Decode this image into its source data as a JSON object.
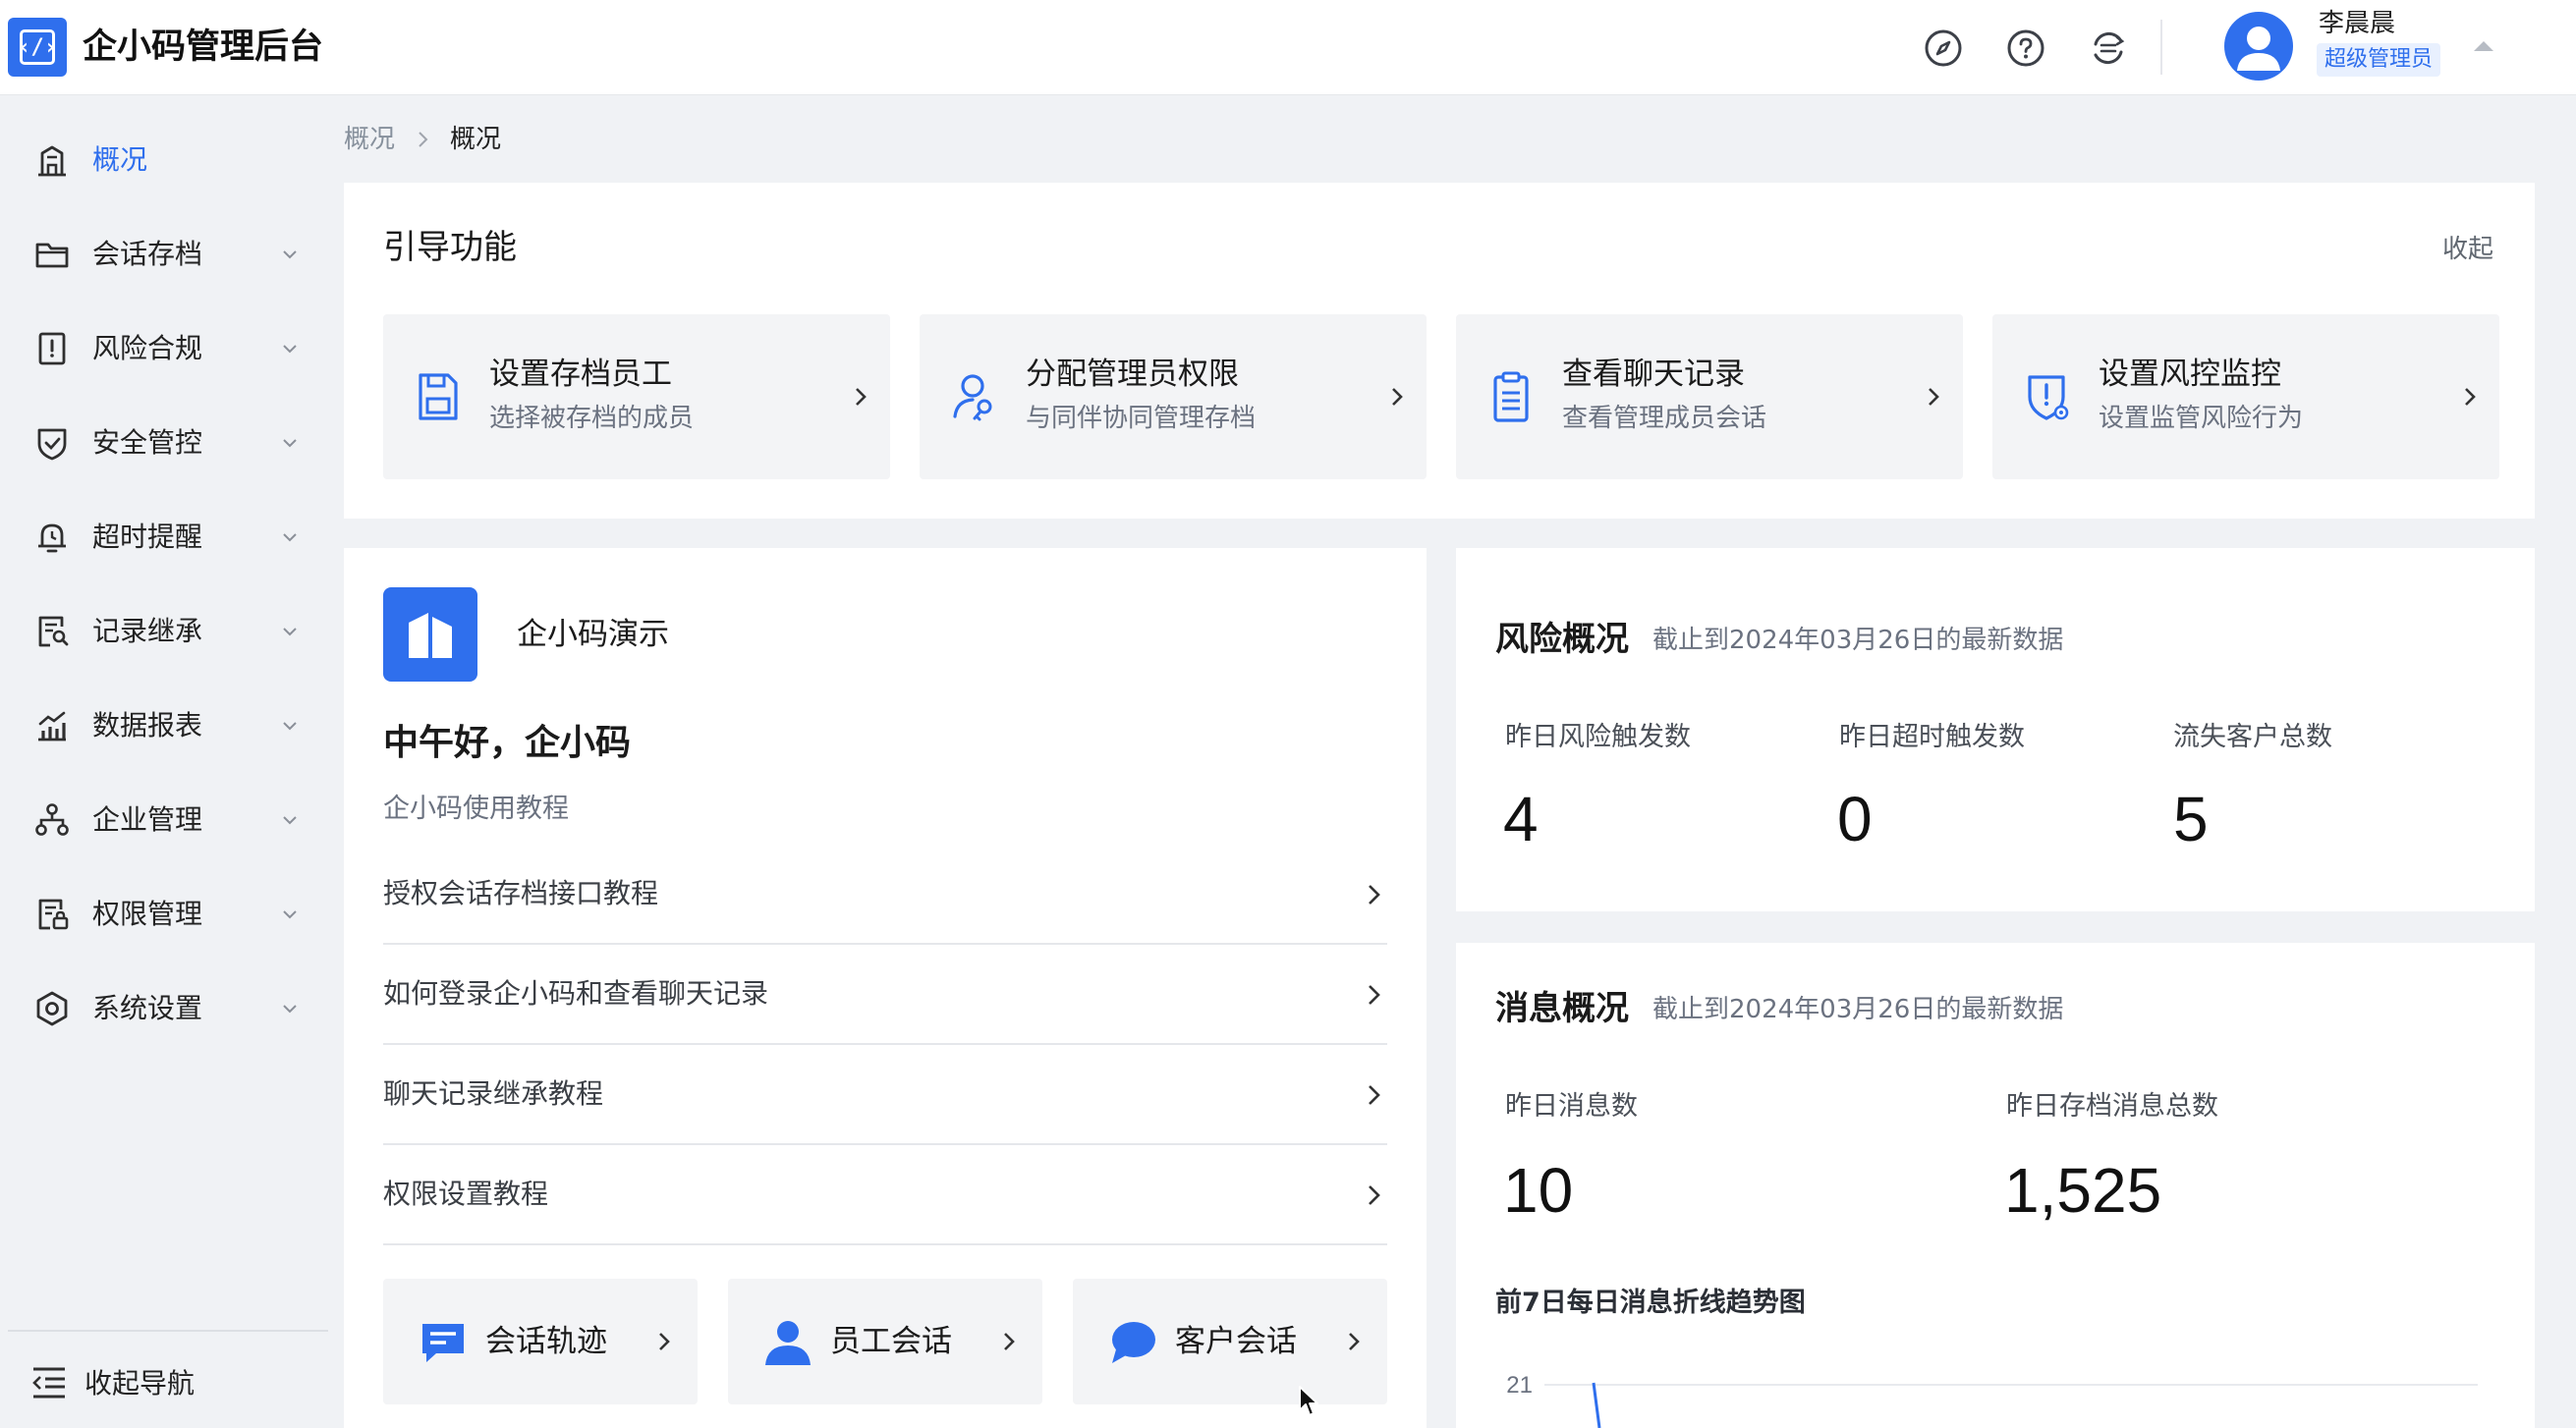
{
  "app": {
    "title": "企小码管理后台",
    "brand_color": "#2f6fed"
  },
  "user": {
    "name": "李晨晨",
    "role": "超级管理员"
  },
  "header_icons": [
    "compass-icon",
    "help-icon",
    "switch-icon"
  ],
  "sidebar": {
    "items": [
      {
        "label": "概况",
        "icon": "building-icon",
        "active": true
      },
      {
        "label": "会话存档",
        "icon": "folder-icon"
      },
      {
        "label": "风险合规",
        "icon": "alert-book-icon"
      },
      {
        "label": "安全管控",
        "icon": "shield-check-icon"
      },
      {
        "label": "超时提醒",
        "icon": "alarm-bell-icon"
      },
      {
        "label": "记录继承",
        "icon": "record-icon"
      },
      {
        "label": "数据报表",
        "icon": "chart-icon"
      },
      {
        "label": "企业管理",
        "icon": "org-tree-icon"
      },
      {
        "label": "权限管理",
        "icon": "permission-icon"
      },
      {
        "label": "系统设置",
        "icon": "settings-icon"
      }
    ],
    "collapse_label": "收起导航"
  },
  "breadcrumb": {
    "parent": "概况",
    "current": "概况"
  },
  "guide": {
    "title": "引导功能",
    "collapse": "收起",
    "items": [
      {
        "title": "设置存档员工",
        "subtitle": "选择被存档的成员",
        "icon": "save-icon"
      },
      {
        "title": "分配管理员权限",
        "subtitle": "与同伴协同管理存档",
        "icon": "user-key-icon"
      },
      {
        "title": "查看聊天记录",
        "subtitle": "查看管理成员会话",
        "icon": "clipboard-icon"
      },
      {
        "title": "设置风控监控",
        "subtitle": "设置监管风险行为",
        "icon": "shield-alert-icon"
      }
    ]
  },
  "demo": {
    "name": "企小码演示",
    "greeting": "中午好，企小码",
    "tutorial_heading": "企小码使用教程",
    "tutorials": [
      "授权会话存档接口教程",
      "如何登录企小码和查看聊天记录",
      "聊天记录继承教程",
      "权限设置教程"
    ],
    "quick_buttons": [
      {
        "label": "会话轨迹",
        "icon": "chat-track-icon"
      },
      {
        "label": "员工会话",
        "icon": "employee-icon"
      },
      {
        "label": "客户会话",
        "icon": "speech-bubble-icon"
      }
    ]
  },
  "risk": {
    "title": "风险概况",
    "subtitle": "截止到2024年03月26日的最新数据",
    "stats": [
      {
        "label": "昨日风险触发数",
        "value": "4"
      },
      {
        "label": "昨日超时触发数",
        "value": "0"
      },
      {
        "label": "流失客户总数",
        "value": "5"
      }
    ]
  },
  "messages": {
    "title": "消息概况",
    "subtitle": "截止到2024年03月26日的最新数据",
    "stats": [
      {
        "label": "昨日消息数",
        "value": "10"
      },
      {
        "label": "昨日存档消息总数",
        "value": "1,525"
      }
    ],
    "trend_title": "前7日每日消息折线趋势图",
    "trend_top_tick": "21"
  }
}
